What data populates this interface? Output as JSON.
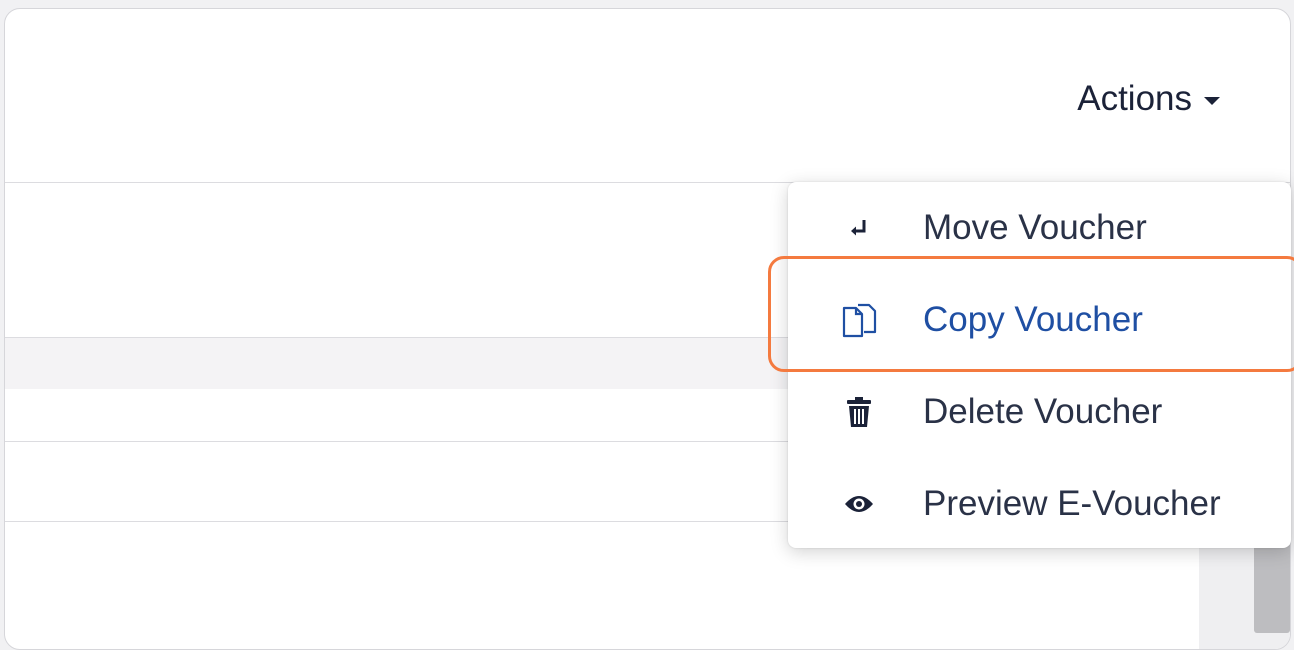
{
  "header": {
    "actions_label": "Actions"
  },
  "menu": {
    "items": [
      {
        "label": "Move Voucher",
        "icon": "move-icon"
      },
      {
        "label": "Copy Voucher",
        "icon": "copy-icon"
      },
      {
        "label": "Delete Voucher",
        "icon": "trash-icon"
      },
      {
        "label": "Preview E-Voucher",
        "icon": "eye-icon"
      }
    ],
    "active_index": 1
  },
  "colors": {
    "text_dark": "#1b2238",
    "active_text": "#1f4fa3",
    "highlight_border": "#f47a3f"
  }
}
